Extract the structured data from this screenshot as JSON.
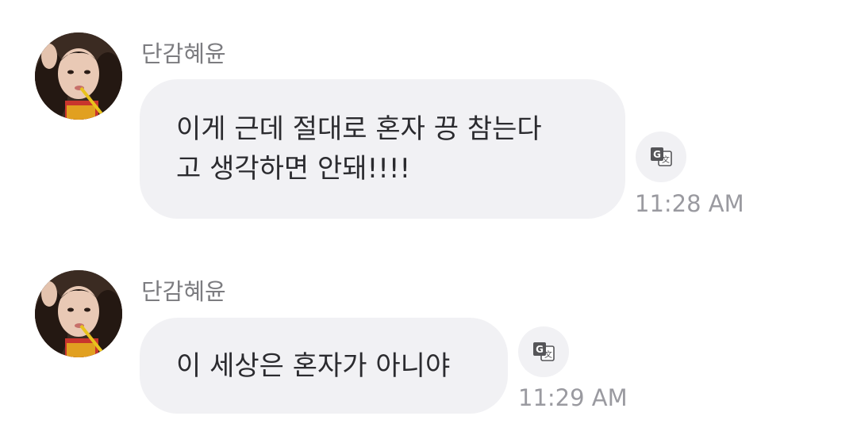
{
  "messages": [
    {
      "sender": "단감혜윤",
      "text_lines": [
        "이게 근데 절대로 혼자 끙 참는다",
        "고 생각하면 안돼!!!!"
      ],
      "time": "11:28 AM",
      "translate_icon": "translate-icon"
    },
    {
      "sender": "단감혜윤",
      "text_lines": [
        "이 세상은 혼자가 아니야"
      ],
      "time": "11:29 AM",
      "translate_icon": "translate-icon"
    }
  ],
  "colors": {
    "bubble_bg": "#f1f1f4",
    "text": "#2b2b2f",
    "sender": "#7c7c80",
    "time": "#9a9aa0"
  }
}
